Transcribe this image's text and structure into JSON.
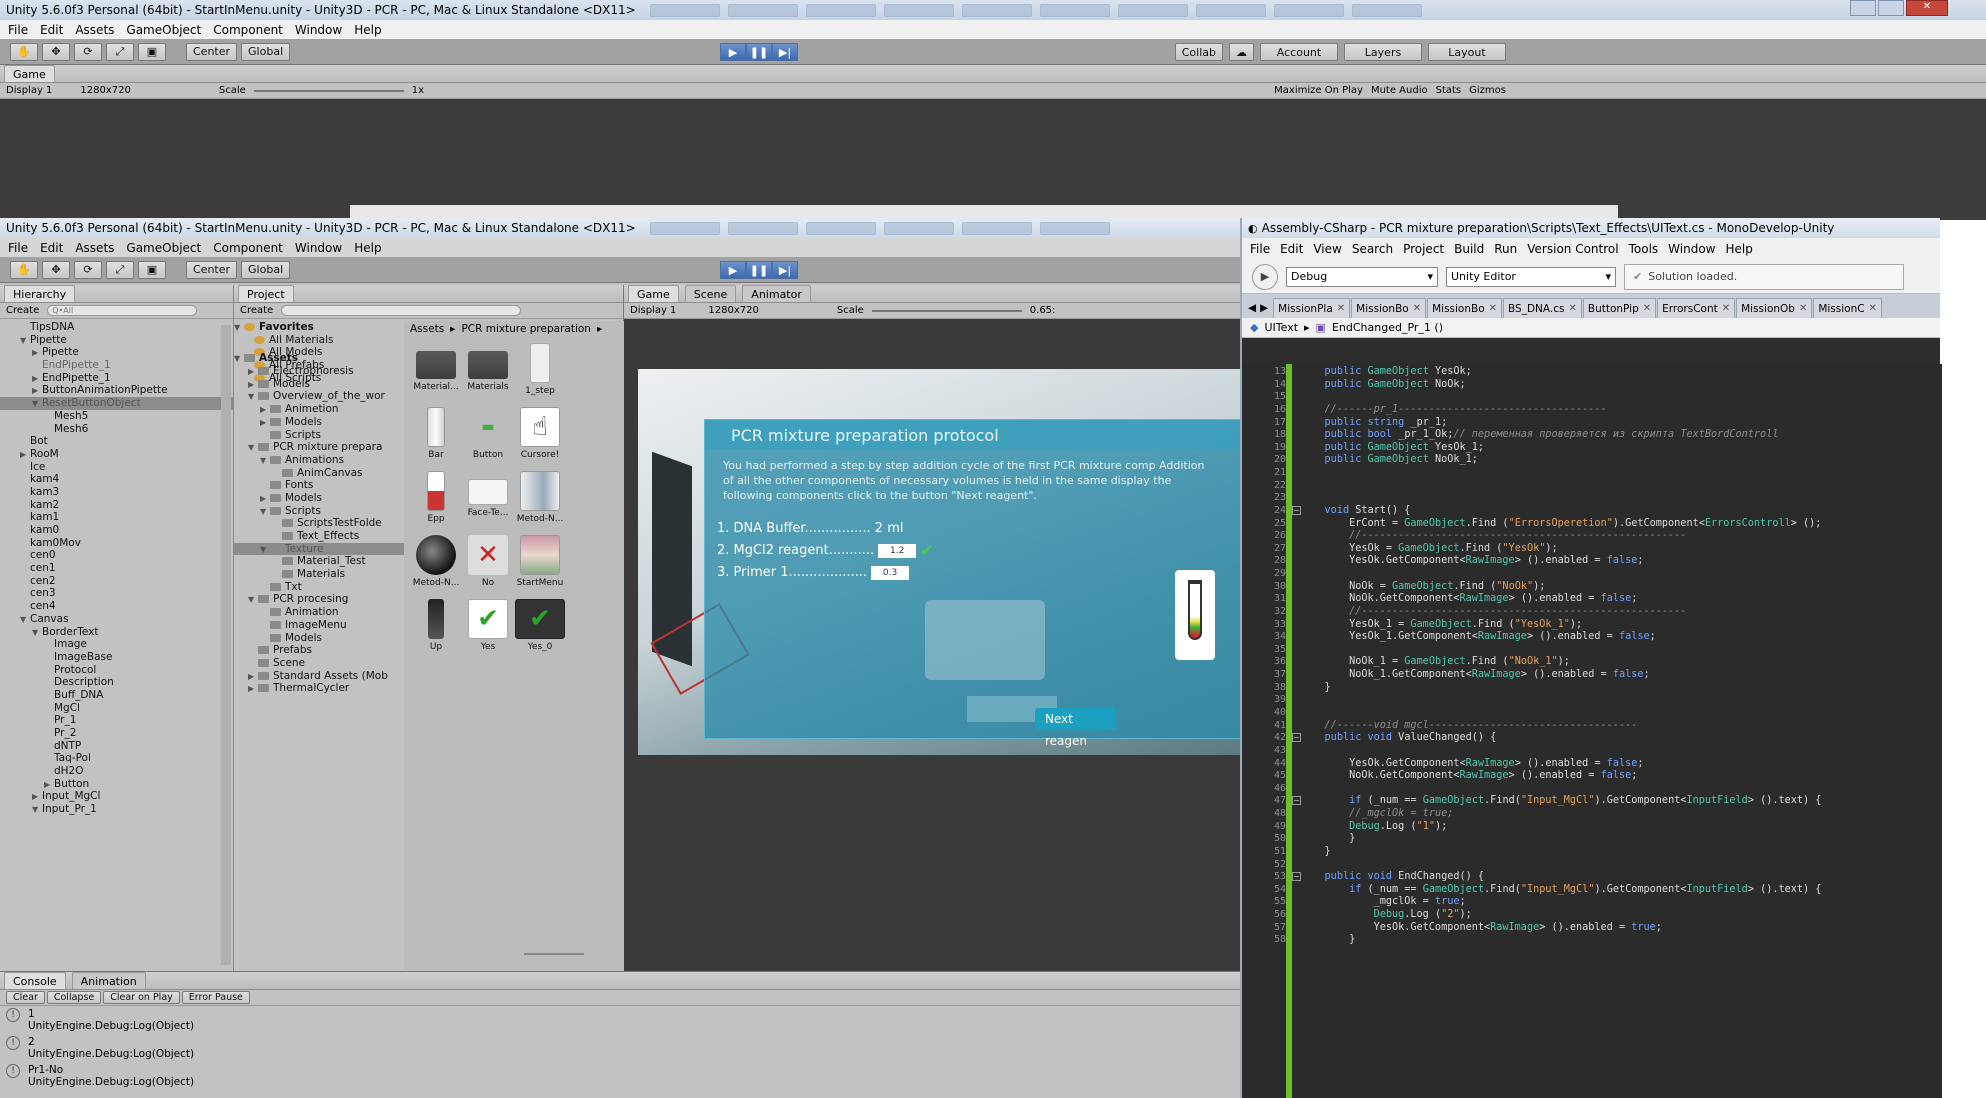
{
  "back_window": {
    "title": "Unity 5.6.0f3 Personal (64bit) - StartInMenu.unity - Unity3D - PCR - PC, Mac & Linux Standalone <DX11>",
    "menu": [
      "File",
      "Edit",
      "Assets",
      "GameObject",
      "Component",
      "Window",
      "Help"
    ],
    "toolbar": {
      "center": "Center",
      "global": "Global",
      "collab": "Collab",
      "account": "Account",
      "layers": "Layers",
      "layout": "Layout"
    },
    "game_tab": "Game",
    "display": "Display 1",
    "resolution": "1280x720",
    "scale_label": "Scale",
    "scale_value": "1x",
    "right_opts": [
      "Maximize On Play",
      "Mute Audio",
      "Stats",
      "Gizmos"
    ]
  },
  "front_window": {
    "title": "Unity 5.6.0f3 Personal (64bit) - StartInMenu.unity - Unity3D - PCR - PC, Mac & Linux Standalone <DX11>",
    "menu": [
      "File",
      "Edit",
      "Assets",
      "GameObject",
      "Component",
      "Window",
      "Help"
    ],
    "toolbar": {
      "center": "Center",
      "global": "Global"
    },
    "hierarchy": {
      "tab": "Hierarchy",
      "create": "Create",
      "search": "Q•All",
      "items": [
        {
          "t": "TipsDNA",
          "d": 1,
          "f": ""
        },
        {
          "t": "Pipette",
          "d": 1,
          "f": "▼"
        },
        {
          "t": "Pipette",
          "d": 2,
          "f": "▶"
        },
        {
          "t": "EndPipette_1",
          "d": 2,
          "f": "",
          "dim": true
        },
        {
          "t": "EndPipette_1",
          "d": 2,
          "f": "▶"
        },
        {
          "t": "ButtonAnimationPipette",
          "d": 2,
          "f": "▶"
        },
        {
          "t": "ResetButtonObject",
          "d": 2,
          "f": "▼",
          "sel": true
        },
        {
          "t": "Mesh5",
          "d": 3,
          "f": ""
        },
        {
          "t": "Mesh6",
          "d": 3,
          "f": ""
        },
        {
          "t": "Bot",
          "d": 1,
          "f": ""
        },
        {
          "t": "RooM",
          "d": 1,
          "f": "▶"
        },
        {
          "t": "Ice",
          "d": 1,
          "f": ""
        },
        {
          "t": "kam4",
          "d": 1,
          "f": ""
        },
        {
          "t": "kam3",
          "d": 1,
          "f": ""
        },
        {
          "t": "kam2",
          "d": 1,
          "f": ""
        },
        {
          "t": "kam1",
          "d": 1,
          "f": ""
        },
        {
          "t": "kam0",
          "d": 1,
          "f": ""
        },
        {
          "t": "kam0Mov",
          "d": 1,
          "f": ""
        },
        {
          "t": "cen0",
          "d": 1,
          "f": ""
        },
        {
          "t": "cen1",
          "d": 1,
          "f": ""
        },
        {
          "t": "cen2",
          "d": 1,
          "f": ""
        },
        {
          "t": "cen3",
          "d": 1,
          "f": ""
        },
        {
          "t": "cen4",
          "d": 1,
          "f": ""
        },
        {
          "t": "Canvas",
          "d": 1,
          "f": "▼"
        },
        {
          "t": "BorderText",
          "d": 2,
          "f": "▼"
        },
        {
          "t": "Image",
          "d": 3,
          "f": ""
        },
        {
          "t": "ImageBase",
          "d": 3,
          "f": ""
        },
        {
          "t": "Protocol",
          "d": 3,
          "f": ""
        },
        {
          "t": "Description",
          "d": 3,
          "f": ""
        },
        {
          "t": "Buff_DNA",
          "d": 3,
          "f": ""
        },
        {
          "t": "MgCl",
          "d": 3,
          "f": ""
        },
        {
          "t": "Pr_1",
          "d": 3,
          "f": ""
        },
        {
          "t": "Pr_2",
          "d": 3,
          "f": ""
        },
        {
          "t": "dNTP",
          "d": 3,
          "f": ""
        },
        {
          "t": "Taq-Pol",
          "d": 3,
          "f": ""
        },
        {
          "t": "dH2O",
          "d": 3,
          "f": ""
        },
        {
          "t": "Button",
          "d": 3,
          "f": "▶"
        },
        {
          "t": "Input_MgCl",
          "d": 2,
          "f": "▶"
        },
        {
          "t": "Input_Pr_1",
          "d": 2,
          "f": "▼"
        }
      ]
    },
    "project": {
      "tab": "Project",
      "create": "Create",
      "favorites_label": "Favorites",
      "favorites": [
        "All Materials",
        "All Models",
        "All Prefabs",
        "All Scripts"
      ],
      "assets_label": "Assets",
      "tree": [
        {
          "t": "Electrophoresis",
          "d": 1,
          "f": "▶"
        },
        {
          "t": "Models",
          "d": 1,
          "f": "▶"
        },
        {
          "t": "Overview_of_the_wor",
          "d": 1,
          "f": "▼"
        },
        {
          "t": "Animetion",
          "d": 2,
          "f": "▶"
        },
        {
          "t": "Models",
          "d": 2,
          "f": "▶"
        },
        {
          "t": "Scripts",
          "d": 2,
          "f": ""
        },
        {
          "t": "PCR mixture prepara",
          "d": 1,
          "f": "▼"
        },
        {
          "t": "Animations",
          "d": 2,
          "f": "▼"
        },
        {
          "t": "AnimCanvas",
          "d": 3,
          "f": ""
        },
        {
          "t": "Fonts",
          "d": 2,
          "f": ""
        },
        {
          "t": "Models",
          "d": 2,
          "f": "▶"
        },
        {
          "t": "Scripts",
          "d": 2,
          "f": "▼"
        },
        {
          "t": "ScriptsTestFolde",
          "d": 3,
          "f": ""
        },
        {
          "t": "Text_Effects",
          "d": 3,
          "f": ""
        },
        {
          "t": "Texture",
          "d": 2,
          "f": "▼",
          "sel": true
        },
        {
          "t": "Material_Test",
          "d": 3,
          "f": ""
        },
        {
          "t": "Materials",
          "d": 3,
          "f": ""
        },
        {
          "t": "Txt",
          "d": 2,
          "f": ""
        },
        {
          "t": "PCR procesing",
          "d": 1,
          "f": "▼"
        },
        {
          "t": "Animation",
          "d": 2,
          "f": ""
        },
        {
          "t": "ImageMenu",
          "d": 2,
          "f": ""
        },
        {
          "t": "Models",
          "d": 2,
          "f": ""
        },
        {
          "t": "Prefabs",
          "d": 1,
          "f": ""
        },
        {
          "t": "Scene",
          "d": 1,
          "f": ""
        },
        {
          "t": "Standard Assets (Mob",
          "d": 1,
          "f": "▶"
        },
        {
          "t": "ThermalCycler",
          "d": 1,
          "f": "▶"
        }
      ],
      "breadcrumb": [
        "Assets",
        "PCR mixture preparation"
      ],
      "assets": [
        {
          "n": "Material...",
          "k": "folder"
        },
        {
          "n": "Materials",
          "k": "folder"
        },
        {
          "n": "1_step",
          "k": "step"
        },
        {
          "n": "Bar",
          "k": "bar"
        },
        {
          "n": "Button",
          "k": "button"
        },
        {
          "n": "Cursore!",
          "k": "hand"
        },
        {
          "n": "Epp",
          "k": "epp"
        },
        {
          "n": "Face-Te...",
          "k": "face"
        },
        {
          "n": "Metod-N...",
          "k": "metod1"
        },
        {
          "n": "Metod-N...",
          "k": "metod2"
        },
        {
          "n": "No",
          "k": "no"
        },
        {
          "n": "StartMenu",
          "k": "start"
        },
        {
          "n": "Up",
          "k": "up"
        },
        {
          "n": "Yes",
          "k": "yes"
        },
        {
          "n": "Yes_0",
          "k": "yes0"
        }
      ]
    },
    "game": {
      "tabs": [
        "Game",
        "Scene",
        "Animator"
      ],
      "display": "Display 1",
      "resolution": "1280x720",
      "scale_label": "Scale",
      "scale_value": "0.65:",
      "protocol": {
        "title": "PCR mixture preparation protocol",
        "description": "You had performed a step by step addition cycle of the first PCR mixture comp Addition of all the other components of necessary volumes is held in the same display the following components click to the button \"Next reagent\".",
        "line1": "1. DNA Buffer................ 2 ml",
        "line2": "2. MgCl2 reagent...........",
        "line2_value": "1.2",
        "line3": "3. Primer 1...................",
        "line3_value": "0.3",
        "next": "Next reagen"
      }
    },
    "console": {
      "tabs": [
        "Console",
        "Animation"
      ],
      "buttons": [
        "Clear",
        "Collapse",
        "Clear on Play",
        "Error Pause"
      ],
      "logs": [
        {
          "a": "1",
          "b": "UnityEngine.Debug:Log(Object)"
        },
        {
          "a": "2",
          "b": "UnityEngine.Debug:Log(Object)"
        },
        {
          "a": "Pr1-No",
          "b": "UnityEngine.Debug:Log(Object)"
        }
      ]
    }
  },
  "monodevelop": {
    "title": "Assembly-CSharp - PCR mixture preparation\\Scripts\\Text_Effects\\UIText.cs - MonoDevelop-Unity",
    "menu": [
      "File",
      "Edit",
      "View",
      "Search",
      "Project",
      "Build",
      "Run",
      "Version Control",
      "Tools",
      "Window",
      "Help"
    ],
    "config": "Debug",
    "target": "Unity Editor",
    "status": "Solution loaded.",
    "tabs": [
      "MissionPla",
      "MissionBo",
      "MissionBo",
      "BS_DNA.cs",
      "ButtonPip",
      "ErrorsCont",
      "MissionOb",
      "MissionC"
    ],
    "crumb1": "UIText",
    "crumb2": "EndChanged_Pr_1 ()",
    "code": [
      {
        "n": "13",
        "c": "    public GameObject YesOk;"
      },
      {
        "n": "14",
        "c": "    public GameObject NoOk;"
      },
      {
        "n": "15",
        "c": ""
      },
      {
        "n": "16",
        "c": "    //------pr_1----------------------------------"
      },
      {
        "n": "17",
        "c": "    public string _pr_1;"
      },
      {
        "n": "18",
        "c": "    public bool _pr_1_Ok;// переменная проверяется из скрипта TextBordControll"
      },
      {
        "n": "19",
        "c": "    public GameObject YesOk_1;"
      },
      {
        "n": "20",
        "c": "    public GameObject NoOk_1;"
      },
      {
        "n": "21",
        "c": ""
      },
      {
        "n": "22",
        "c": ""
      },
      {
        "n": "23",
        "c": ""
      },
      {
        "n": "24",
        "c": "    void Start() {"
      },
      {
        "n": "25",
        "c": "        ErCont = GameObject.Find (\"ErrorsOperetion\").GetComponent<ErrorsControll> ();"
      },
      {
        "n": "26",
        "c": "        //-----------------------------------------------------"
      },
      {
        "n": "27",
        "c": "        YesOk = GameObject.Find (\"YesOk\");"
      },
      {
        "n": "28",
        "c": "        YesOk.GetComponent<RawImage> ().enabled = false;"
      },
      {
        "n": "29",
        "c": ""
      },
      {
        "n": "30",
        "c": "        NoOk = GameObject.Find (\"NoOk\");"
      },
      {
        "n": "31",
        "c": "        NoOk.GetComponent<RawImage> ().enabled = false;"
      },
      {
        "n": "32",
        "c": "        //-----------------------------------------------------"
      },
      {
        "n": "33",
        "c": "        YesOk_1 = GameObject.Find (\"YesOk_1\");"
      },
      {
        "n": "34",
        "c": "        YesOk_1.GetComponent<RawImage> ().enabled = false;"
      },
      {
        "n": "35",
        "c": ""
      },
      {
        "n": "36",
        "c": "        NoOk_1 = GameObject.Find (\"NoOk_1\");"
      },
      {
        "n": "37",
        "c": "        NoOk_1.GetComponent<RawImage> ().enabled = false;"
      },
      {
        "n": "38",
        "c": "    }"
      },
      {
        "n": "39",
        "c": ""
      },
      {
        "n": "40",
        "c": ""
      },
      {
        "n": "41",
        "c": "    //------void mgcl----------------------------------"
      },
      {
        "n": "42",
        "c": "    public void ValueChanged() {"
      },
      {
        "n": "43",
        "c": ""
      },
      {
        "n": "44",
        "c": "        YesOk.GetComponent<RawImage> ().enabled = false;"
      },
      {
        "n": "45",
        "c": "        NoOk.GetComponent<RawImage> ().enabled = false;"
      },
      {
        "n": "46",
        "c": ""
      },
      {
        "n": "47",
        "c": "        if (_num == GameObject.Find(\"Input_MgCl\").GetComponent<InputField> ().text) {"
      },
      {
        "n": "48",
        "c": "        //_mgclOk = true;"
      },
      {
        "n": "49",
        "c": "        Debug.Log (\"1\");"
      },
      {
        "n": "50",
        "c": "        }"
      },
      {
        "n": "51",
        "c": "    }"
      },
      {
        "n": "52",
        "c": ""
      },
      {
        "n": "53",
        "c": "    public void EndChanged() {"
      },
      {
        "n": "54",
        "c": "        if (_num == GameObject.Find(\"Input_MgCl\").GetComponent<InputField> ().text) {"
      },
      {
        "n": "55",
        "c": "            _mgclOk = true;"
      },
      {
        "n": "56",
        "c": "            Debug.Log (\"2\");"
      },
      {
        "n": "57",
        "c": "            YesOk.GetComponent<RawImage> ().enabled = true;"
      },
      {
        "n": "58",
        "c": "        }"
      }
    ]
  }
}
